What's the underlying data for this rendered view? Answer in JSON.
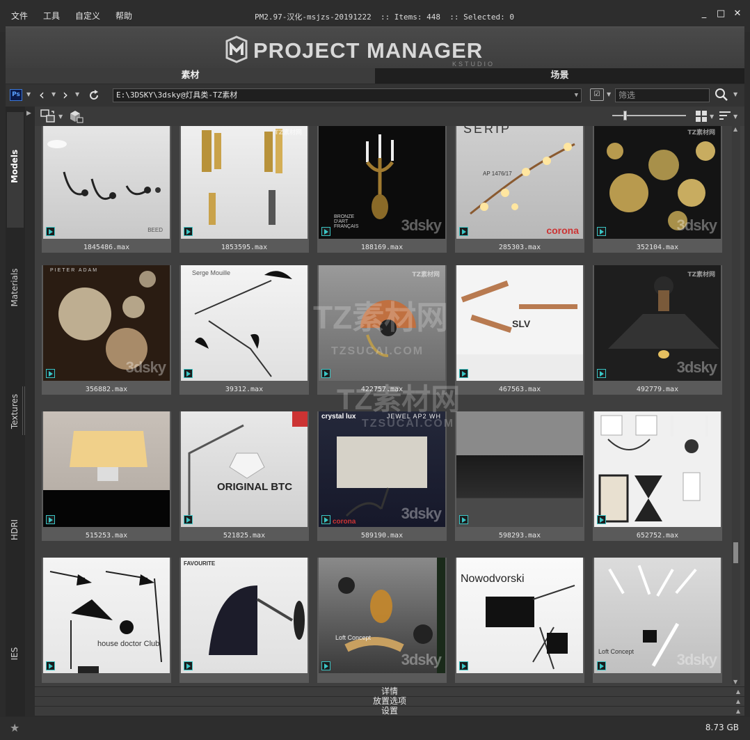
{
  "menu": [
    "文件",
    "工具",
    "自定义",
    "帮助"
  ],
  "window_title": "PM2.97-汉化-msjzs-20191222  :: Items: 448  :: Selected: 0",
  "window_controls": {
    "minimize": "_",
    "maximize": "□",
    "close": "✕"
  },
  "banner": {
    "logo": "PROJECT MANAGER",
    "sub": "KSTUDIO"
  },
  "tabs": [
    {
      "label": "素材",
      "active": true
    },
    {
      "label": "场景",
      "active": false
    }
  ],
  "toolbar": {
    "ps_label": "Ps",
    "path": "E:\\3DSKY\\3dsky@灯具类-TZ素材",
    "filter_placeholder": "筛选"
  },
  "sidebar": [
    {
      "label": "Models",
      "active": true
    },
    {
      "label": "Materials",
      "active": false
    },
    {
      "label": "Textures",
      "active": false
    },
    {
      "label": "HDRI",
      "active": false
    },
    {
      "label": "IES",
      "active": false
    }
  ],
  "items": [
    {
      "name": "1845486.max",
      "brand": "BEED"
    },
    {
      "name": "1853595.max",
      "brand": ""
    },
    {
      "name": "188169.max",
      "brand": "BRONZE D'ART FRANÇAIS"
    },
    {
      "name": "285303.max",
      "brand": "SERIP",
      "model": "AP 1476/17",
      "render": "corona"
    },
    {
      "name": "352104.max",
      "brand": ""
    },
    {
      "name": "356882.max",
      "brand": "PIETER ADAM"
    },
    {
      "name": "39312.max",
      "brand": "Serge Mouille"
    },
    {
      "name": "422757.max",
      "brand": ""
    },
    {
      "name": "467563.max",
      "brand": "SLV"
    },
    {
      "name": "492779.max",
      "brand": ""
    },
    {
      "name": "515253.max",
      "brand": ""
    },
    {
      "name": "521825.max",
      "brand": "ORIGINAL BTC"
    },
    {
      "name": "589190.max",
      "brand": "crystal lux",
      "model": "JEWEL AP2 WH",
      "render": "corona"
    },
    {
      "name": "598293.max",
      "brand": ""
    },
    {
      "name": "652752.max",
      "brand": ""
    },
    {
      "name": "",
      "brand": "house doctor Club"
    },
    {
      "name": "",
      "brand": "FAVOURITE"
    },
    {
      "name": "",
      "brand": "Loft Concept"
    },
    {
      "name": "",
      "brand": "Nowodvorski"
    },
    {
      "name": "",
      "brand": "Loft Concept"
    }
  ],
  "watermark": {
    "small": "TZ素材网",
    "stock": "3dsky",
    "big": "TZ素材网",
    "big_url": "TZSUCAI.COM"
  },
  "panels": [
    "详情",
    "放置选项",
    "设置"
  ],
  "status": {
    "disk": "8.73 GB"
  },
  "colors": {
    "accent_teal": "#3ac6c6",
    "bg": "#2b2b2b"
  }
}
